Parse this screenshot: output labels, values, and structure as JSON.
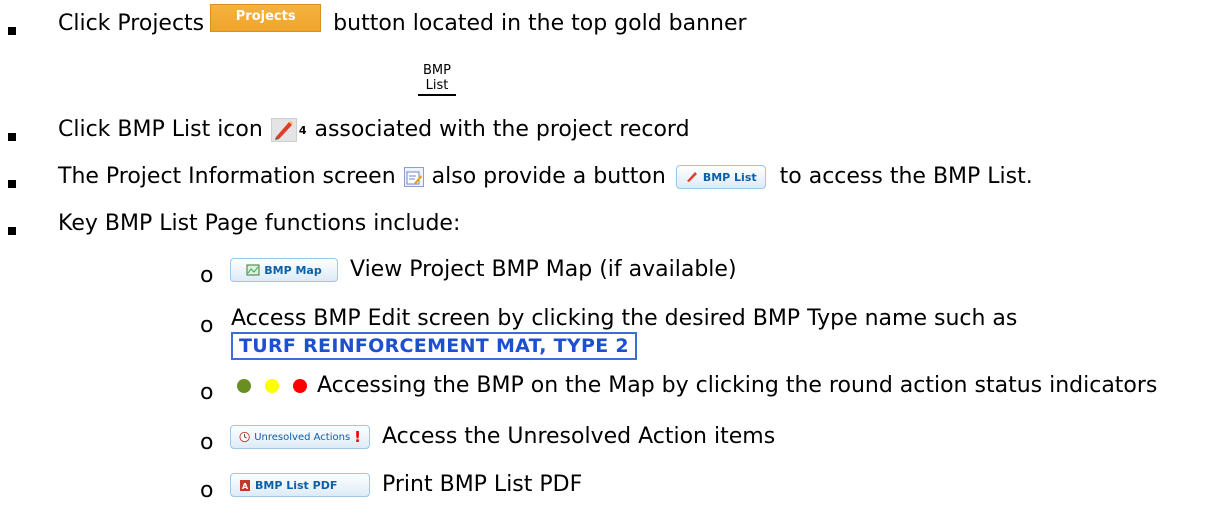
{
  "line1": {
    "before": "Click Projects",
    "button": "Projects",
    "after": "button located in the top gold banner"
  },
  "bmp_list_header": "BMP List",
  "line2": {
    "before": "Click BMP List icon",
    "superscript": "4",
    "after": "associated with the project record"
  },
  "line3": {
    "before": "The Project Information screen",
    "middle": "also provide a button",
    "button": "BMP List",
    "after": "to access the BMP List."
  },
  "line4": "Key BMP List Page functions include:",
  "sub": {
    "bmp_map_button": "BMP Map",
    "bmp_map_text": "View Project BMP Map (if available)",
    "edit_text": "Access BMP Edit screen by clicking the desired BMP Type name such as",
    "turf_label": "TURF REINFORCEMENT MAT, TYPE 2",
    "dots_text": "Accessing the BMP on the Map by clicking the round action status indicators",
    "unresolved_button": "Unresolved Actions",
    "unresolved_mark": "!",
    "unresolved_text": "Access the Unresolved Action items",
    "pdf_button": "BMP List PDF",
    "pdf_text": "Print BMP List PDF"
  },
  "colors": {
    "gold": "#f0a52c",
    "turf_blue": "#1d4fd1",
    "dot_green": "#6b8e23",
    "dot_yellow": "#ffff00",
    "dot_red": "#ff0000"
  }
}
